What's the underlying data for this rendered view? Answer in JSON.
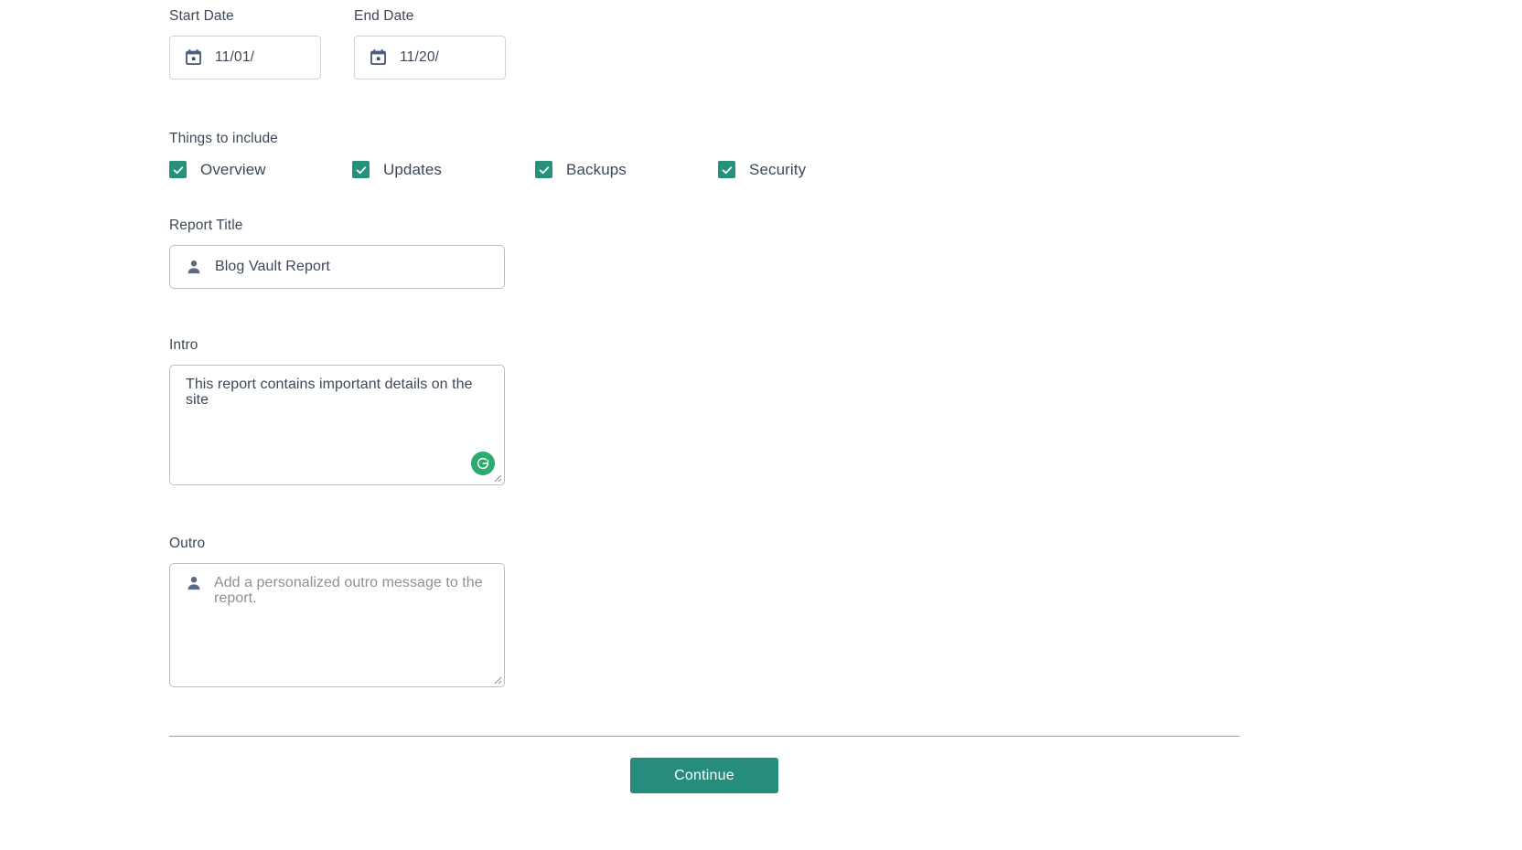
{
  "form": {
    "start_date": {
      "label": "Start Date",
      "value": "11/01/",
      "icon": "calendar-icon"
    },
    "end_date": {
      "label": "End Date",
      "value": "11/20/",
      "icon": "calendar-icon"
    },
    "things_to_include": {
      "label": "Things to include",
      "options": [
        {
          "label": "Overview",
          "checked": true
        },
        {
          "label": "Updates",
          "checked": true
        },
        {
          "label": "Backups",
          "checked": true
        },
        {
          "label": "Security",
          "checked": true
        }
      ]
    },
    "report_title": {
      "label": "Report Title",
      "value": "Blog Vault Report",
      "icon": "person-icon"
    },
    "intro": {
      "label": "Intro",
      "value": "This report contains important details on the site",
      "icon": "person-icon",
      "badge_icon": "grammarly-refresh-icon"
    },
    "outro": {
      "label": "Outro",
      "value": "",
      "placeholder": "Add a personalized outro message to the report.",
      "icon": "person-icon"
    },
    "continue_label": "Continue"
  },
  "colors": {
    "accent_teal": "#268d7c",
    "checkbox_teal": "#28917c",
    "grammarly_green": "#2bab6d",
    "icon_slate": "#5b6b84",
    "text": "#3c4858",
    "placeholder": "#8a9199",
    "border": "#b9bec4",
    "divider": "#9b9b9b"
  }
}
